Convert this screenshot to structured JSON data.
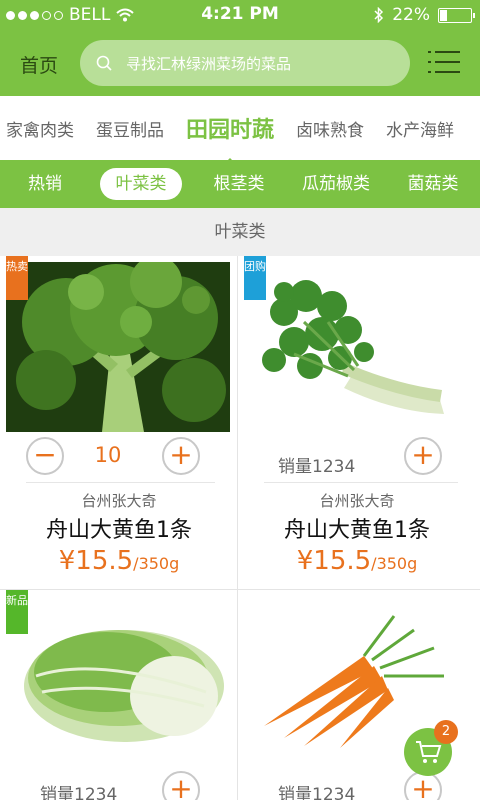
{
  "status": {
    "carrier": "BELL",
    "time": "4:21 PM",
    "battery": "22%",
    "battery_level": 0.22
  },
  "header": {
    "home_label": "首页",
    "search_placeholder": "寻找汇林绿洲菜场的菜品"
  },
  "categories": [
    {
      "label": "家禽肉类",
      "active": false
    },
    {
      "label": "蛋豆制品",
      "active": false
    },
    {
      "label": "田园时蔬",
      "active": true
    },
    {
      "label": "卤味熟食",
      "active": false
    },
    {
      "label": "水产海鲜",
      "active": false
    }
  ],
  "subcategories": [
    {
      "label": "热销",
      "active": false
    },
    {
      "label": "叶菜类",
      "active": true
    },
    {
      "label": "根茎类",
      "active": false
    },
    {
      "label": "瓜茄椒类",
      "active": false
    },
    {
      "label": "菌菇类",
      "active": false
    }
  ],
  "section_title": "叶菜类",
  "products": [
    {
      "badge": "热卖",
      "badge_type": "hot",
      "image": "broccoli",
      "quantity": "10",
      "origin": "台州张大奇",
      "name": "舟山大黄鱼1条",
      "price": "¥15.5",
      "unit": "/350g"
    },
    {
      "badge": "团购",
      "badge_type": "group",
      "image": "celery",
      "sales": "销量1234",
      "origin": "台州张大奇",
      "name": "舟山大黄鱼1条",
      "price": "¥15.5",
      "unit": "/350g"
    },
    {
      "badge": "新品",
      "badge_type": "new",
      "image": "chinese-cabbage",
      "sales": "销量1234"
    },
    {
      "image": "carrots",
      "sales": "销量1234"
    }
  ],
  "cart": {
    "count": "2"
  },
  "icons": {
    "search": "search-icon",
    "menu": "menu-icon",
    "minus": "minus-icon",
    "plus": "plus-icon",
    "cart": "cart-icon"
  },
  "colors": {
    "brand_green": "#7cc243",
    "accent_orange": "#e8711e",
    "group_blue": "#1ea0d8"
  }
}
